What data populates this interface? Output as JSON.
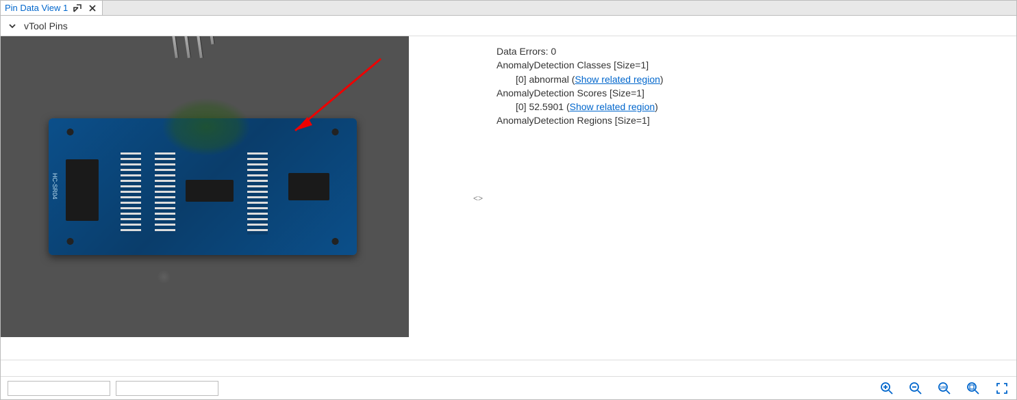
{
  "tab": {
    "title": "Pin Data View 1"
  },
  "section": {
    "title": "vTool Pins"
  },
  "data": {
    "errors_label": "Data Errors: ",
    "errors_value": "0",
    "classes_label": "AnomalyDetection Classes [Size=1]",
    "classes_entry_prefix": "[0] abnormal (",
    "classes_entry_link": "Show related region",
    "classes_entry_suffix": ")",
    "scores_label": "AnomalyDetection Scores [Size=1]",
    "scores_entry_prefix": "[0] 52.5901 (",
    "scores_entry_link": "Show related region",
    "scores_entry_suffix": ")",
    "regions_label": "AnomalyDetection Regions [Size=1]"
  },
  "splitter": {
    "lt": "<",
    "gt": ">"
  },
  "board_label": "HC-SR04"
}
